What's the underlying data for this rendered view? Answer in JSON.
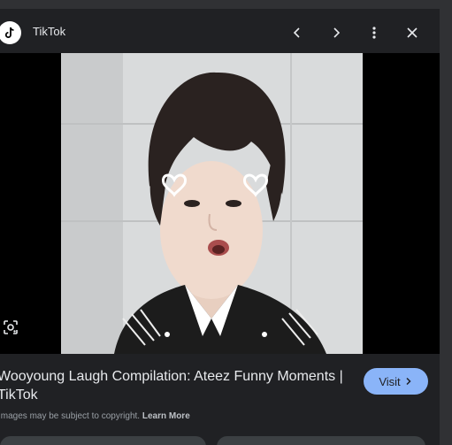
{
  "header": {
    "site_name": "TikTok"
  },
  "result": {
    "title": "Wooyoung Laugh Compilation: Ateez Funny Moments | TikTok",
    "visit_label": "Visit",
    "copyright_text": "Images may be subject to copyright.",
    "learn_more": "Learn More"
  },
  "colors": {
    "panel_bg": "#202124",
    "visit_bg": "#8ab4f8",
    "text": "#e8eaed"
  },
  "icons": [
    "tiktok-logo",
    "chevron-left-icon",
    "chevron-right-icon",
    "more-vert-icon",
    "close-icon",
    "google-lens-icon",
    "chevron-right-small-icon"
  ]
}
